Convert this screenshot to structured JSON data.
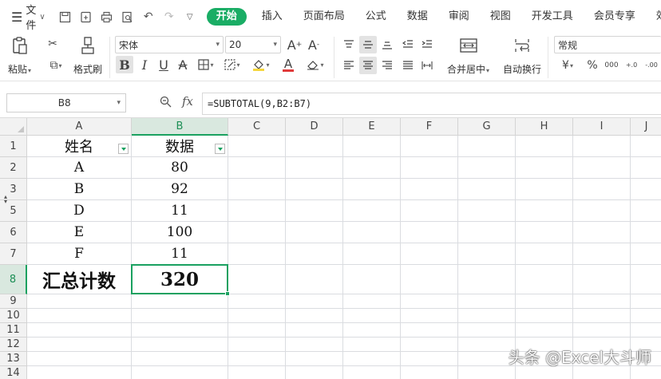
{
  "menubar": {
    "file_label": "文件",
    "tabs": [
      "开始",
      "插入",
      "页面布局",
      "公式",
      "数据",
      "审阅",
      "视图",
      "开发工具",
      "会员专享",
      "效率"
    ],
    "active_tab": "开始",
    "accent_color": "#1aad65"
  },
  "ribbon": {
    "paste_label": "粘贴",
    "format_painter_label": "格式刷",
    "font_name": "宋体",
    "font_size": "20",
    "merge_center_label": "合并居中",
    "wrap_text_label": "自动换行",
    "number_format": "常规",
    "currency_symbol": "¥",
    "percent_symbol": "%",
    "thousands_symbol": "000",
    "inc_decimal_label": "+.0",
    "dec_decimal_label": "-.00",
    "bold_glyph": "B",
    "italic_glyph": "I",
    "underline_glyph": "U",
    "strike_glyph": "A",
    "font_color_glyph": "A",
    "font_color": "#e03a3a",
    "fill_color": "#f5d63d",
    "grow_font_glyph": "A",
    "shrink_font_glyph": "A"
  },
  "formula_bar": {
    "name_box": "B8",
    "fx_label": "fx",
    "formula": "=SUBTOTAL(9,B2:B7)"
  },
  "grid": {
    "columns": [
      "A",
      "B",
      "C",
      "D",
      "E",
      "F",
      "G",
      "H",
      "I",
      "J"
    ],
    "rows": [
      "1",
      "2",
      "3",
      "5",
      "6",
      "7",
      "8",
      "9",
      "10",
      "11",
      "12",
      "13",
      "14"
    ],
    "active_cell": "B8",
    "cells": {
      "A1": "姓名",
      "B1": "数据",
      "A2": "A",
      "B2": "80",
      "A3": "B",
      "B3": "92",
      "A5": "D",
      "B5": "11",
      "A6": "E",
      "B6": "100",
      "A7": "F",
      "B7": "11",
      "A8": "汇总计数",
      "B8": "320"
    }
  },
  "watermark": "头条 @Excel大斗师"
}
